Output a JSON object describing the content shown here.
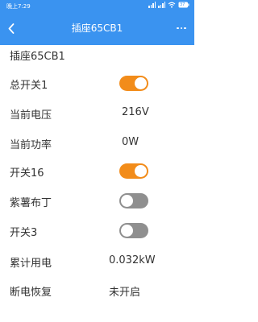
{
  "status_bar": {
    "time": "晚上7:29",
    "battery": "37"
  },
  "header": {
    "title": "插座65CB1",
    "back_icon": "chevron-left-icon",
    "more_icon": "more-dots-icon"
  },
  "device": {
    "name": "插座65CB1"
  },
  "colors": {
    "primary": "#3a93f0",
    "toggle_on": "#f28c1a",
    "toggle_off": "#8f8f8f"
  },
  "rows": [
    {
      "label": "总开关1",
      "type": "toggle",
      "state": "on"
    },
    {
      "label": "当前电压",
      "type": "value",
      "value": "216V"
    },
    {
      "label": "当前功率",
      "type": "value",
      "value": "0W"
    },
    {
      "label": "开关16",
      "type": "toggle",
      "state": "on"
    },
    {
      "label": "紫薯布丁",
      "type": "toggle",
      "state": "off"
    },
    {
      "label": "开关3",
      "type": "toggle",
      "state": "off"
    },
    {
      "label": "累计用电",
      "type": "value",
      "value": "0.032kW"
    },
    {
      "label": "断电恢复",
      "type": "value",
      "value": "未开启"
    }
  ]
}
